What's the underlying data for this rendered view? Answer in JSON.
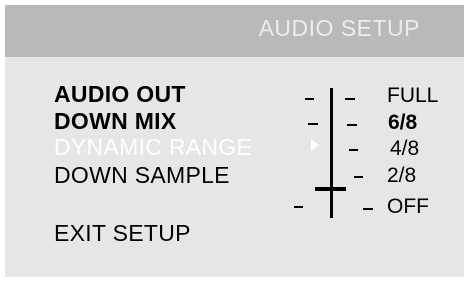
{
  "header": {
    "title": "AUDIO SETUP"
  },
  "menu": {
    "items": [
      {
        "label": "AUDIO OUT"
      },
      {
        "label": "DOWN MIX"
      },
      {
        "label": "DYNAMIC RANGE"
      },
      {
        "label": "DOWN SAMPLE"
      },
      {
        "label": "EXIT  SETUP"
      }
    ],
    "selected_index": 2
  },
  "dynamic_range": {
    "options": [
      "FULL",
      "6/8",
      "4/8",
      "2/8",
      "OFF"
    ],
    "current_value": "6/8",
    "slider_level": "2/8"
  },
  "colors": {
    "panel": "#e6e6e6",
    "header": "#b9b9b9",
    "title_text": "#ececec",
    "selected_text": "#ffffff",
    "text": "#000000"
  },
  "icons": {
    "selection_marker": "triangle-right-icon"
  }
}
